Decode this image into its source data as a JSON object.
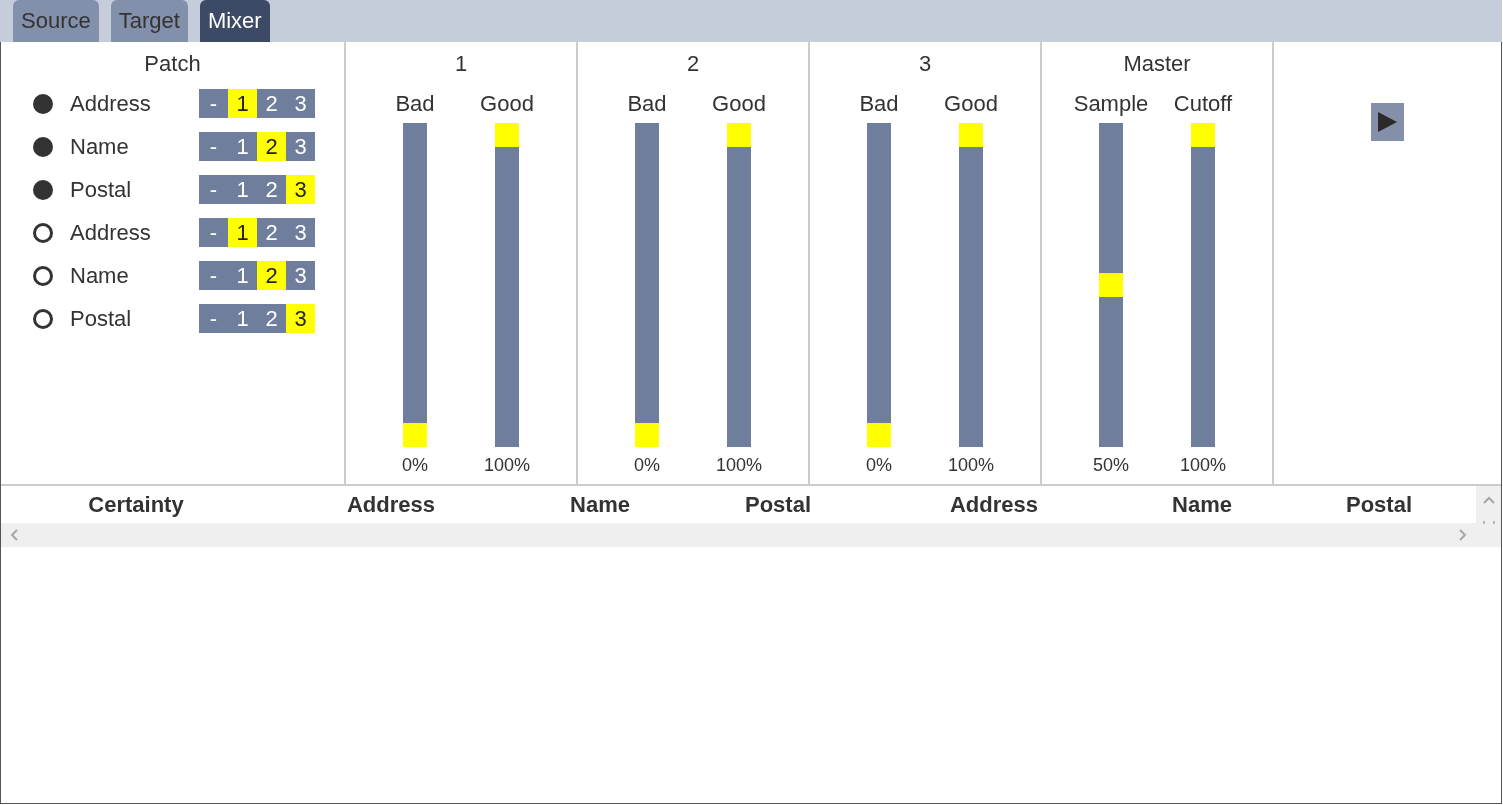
{
  "tabs": [
    {
      "label": "Source",
      "selected": false
    },
    {
      "label": "Target",
      "selected": false
    },
    {
      "label": "Mixer",
      "selected": true
    }
  ],
  "patch": {
    "title": "Patch",
    "rows": [
      {
        "checked": true,
        "label": "Address",
        "options": [
          {
            "label": "-",
            "selected": false
          },
          {
            "label": "1",
            "selected": true
          },
          {
            "label": "2",
            "selected": false
          },
          {
            "label": "3",
            "selected": false
          }
        ]
      },
      {
        "checked": true,
        "label": "Name",
        "options": [
          {
            "label": "-",
            "selected": false
          },
          {
            "label": "1",
            "selected": false
          },
          {
            "label": "2",
            "selected": true
          },
          {
            "label": "3",
            "selected": false
          }
        ]
      },
      {
        "checked": true,
        "label": "Postal",
        "options": [
          {
            "label": "-",
            "selected": false
          },
          {
            "label": "1",
            "selected": false
          },
          {
            "label": "2",
            "selected": false
          },
          {
            "label": "3",
            "selected": true
          }
        ]
      },
      {
        "checked": false,
        "label": "Address",
        "options": [
          {
            "label": "-",
            "selected": false
          },
          {
            "label": "1",
            "selected": true
          },
          {
            "label": "2",
            "selected": false
          },
          {
            "label": "3",
            "selected": false
          }
        ]
      },
      {
        "checked": false,
        "label": "Name",
        "options": [
          {
            "label": "-",
            "selected": false
          },
          {
            "label": "1",
            "selected": false
          },
          {
            "label": "2",
            "selected": true
          },
          {
            "label": "3",
            "selected": false
          }
        ]
      },
      {
        "checked": false,
        "label": "Postal",
        "options": [
          {
            "label": "-",
            "selected": false
          },
          {
            "label": "1",
            "selected": false
          },
          {
            "label": "2",
            "selected": false
          },
          {
            "label": "3",
            "selected": true
          }
        ]
      }
    ]
  },
  "channels": [
    {
      "title": "1",
      "sliders": [
        {
          "label": "Bad",
          "level": 0,
          "reading": "0%"
        },
        {
          "label": "Good",
          "level": 1,
          "reading": "100%"
        }
      ]
    },
    {
      "title": "2",
      "sliders": [
        {
          "label": "Bad",
          "level": 0,
          "reading": "0%"
        },
        {
          "label": "Good",
          "level": 1,
          "reading": "100%"
        }
      ]
    },
    {
      "title": "3",
      "sliders": [
        {
          "label": "Bad",
          "level": 0,
          "reading": "0%"
        },
        {
          "label": "Good",
          "level": 1,
          "reading": "100%"
        }
      ]
    },
    {
      "title": "Master",
      "sliders": [
        {
          "label": "Sample",
          "level": 0.5,
          "reading": "50%"
        },
        {
          "label": "Cutoff",
          "level": 1,
          "reading": "100%"
        }
      ]
    }
  ],
  "table": {
    "columns": [
      "Certainty",
      "Address",
      "Name",
      "Postal",
      "Address",
      "Name",
      "Postal"
    ]
  }
}
